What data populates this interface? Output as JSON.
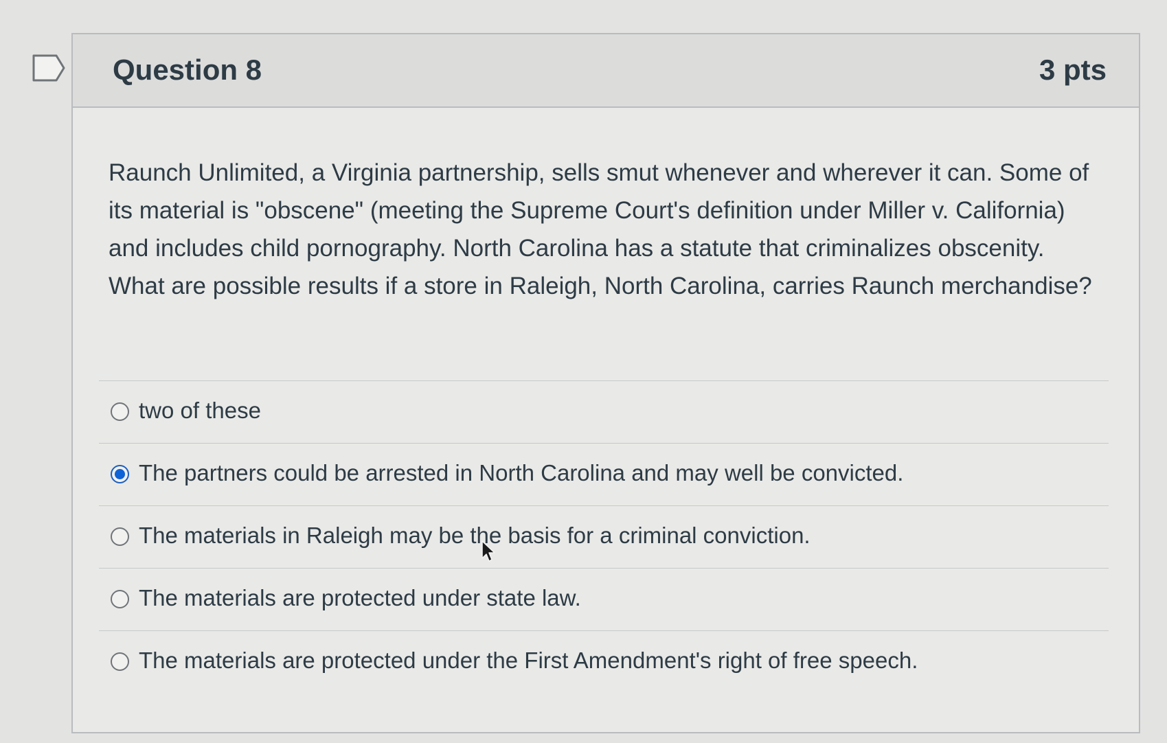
{
  "question": {
    "title": "Question 8",
    "points": "3 pts",
    "text": "Raunch Unlimited, a Virginia partnership, sells smut whenever and wherever it can. Some of its material is \"obscene\" (meeting the Supreme Court's definition under Miller v. California) and includes child pornography. North Carolina has a statute that criminalizes obscenity. What are possible results if a store in Raleigh, North Carolina, carries Raunch merchandise?"
  },
  "answers": [
    {
      "label": "two of these",
      "selected": false
    },
    {
      "label": "The partners could be arrested in North Carolina and may well be convicted.",
      "selected": true
    },
    {
      "label": "The materials in Raleigh may be the basis for a criminal conviction.",
      "selected": false
    },
    {
      "label": "The materials are protected under state law.",
      "selected": false
    },
    {
      "label": "The materials are protected under the First Amendment's right of free speech.",
      "selected": false
    }
  ],
  "icons": {
    "flag": "bookmark-flag-icon",
    "cursor": "mouse-pointer-icon"
  },
  "colors": {
    "accent": "#0e63d6",
    "text": "#2d3b45"
  }
}
